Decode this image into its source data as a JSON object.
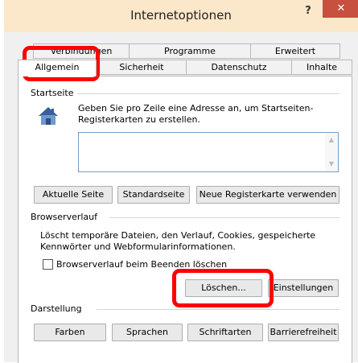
{
  "window": {
    "title": "Internetoptionen",
    "help_label": "?",
    "close_label": "✕"
  },
  "tabs": {
    "row1": [
      "Verbindungen",
      "Programme",
      "Erweitert"
    ],
    "row2": [
      "Allgemein",
      "Sicherheit",
      "Datenschutz",
      "Inhalte"
    ],
    "active": "Allgemein"
  },
  "startseite": {
    "legend": "Startseite",
    "description": "Geben Sie pro Zeile eine Adresse an, um Startseiten-Registerkarten zu erstellen.",
    "buttons": [
      "Aktuelle Seite",
      "Standardseite",
      "Neue Registerkarte verwenden"
    ]
  },
  "browserverlauf": {
    "legend": "Browserverlauf",
    "description": "Löscht temporäre Dateien, den Verlauf, Cookies, gespeicherte Kennwörter und Webformularinformationen.",
    "checkbox_label": "Browserverlauf beim Beenden löschen",
    "checkbox_checked": false,
    "buttons": [
      "Löschen...",
      "Einstellungen"
    ]
  },
  "darstellung": {
    "legend": "Darstellung",
    "buttons": [
      "Farben",
      "Sprachen",
      "Schriftarten",
      "Barrierefreiheit"
    ]
  },
  "colors": {
    "titlebar": "#fbe7c9",
    "close_button": "#c7503e",
    "highlight": "#ff0000"
  },
  "icons": {
    "startseite": "home-icon"
  }
}
